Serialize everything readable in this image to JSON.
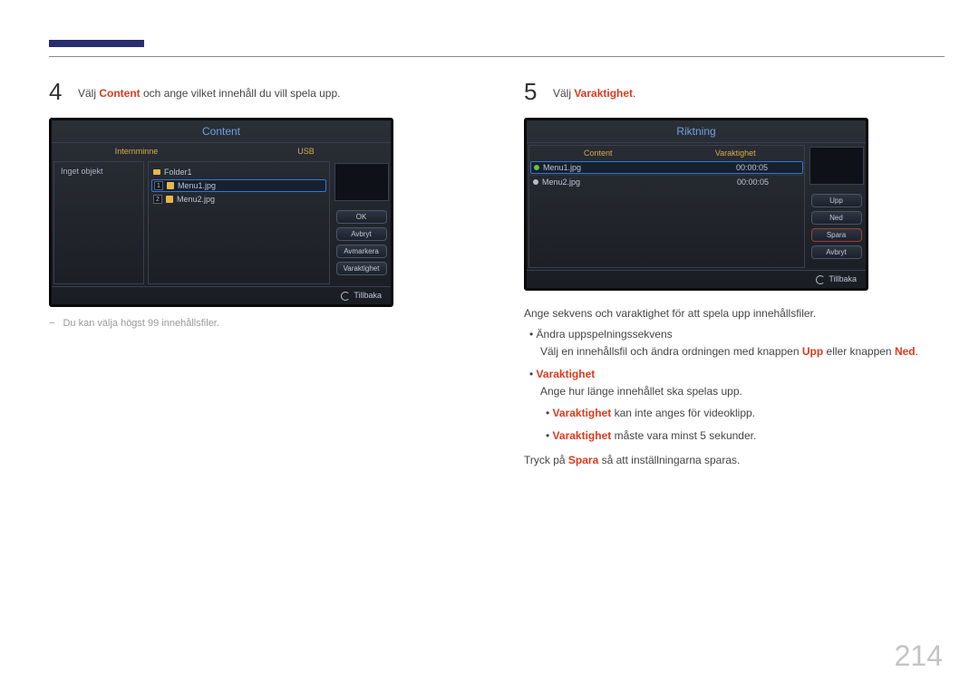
{
  "page_number": "214",
  "step4": {
    "num": "4",
    "text_prefix": "Välj ",
    "text_bold": "Content",
    "text_suffix": " och ange vilket innehåll du vill spela upp.",
    "note_prefix": "− ",
    "note": "Du kan välja högst 99 innehållsfiler."
  },
  "screen4": {
    "title": "Content",
    "tab1": "Internminne",
    "tab2": "USB",
    "left_label": "Inget objekt",
    "folder": "Folder1",
    "file1_idx": "1",
    "file1": "Menu1.jpg",
    "file2_idx": "2",
    "file2": "Menu2.jpg",
    "btn_ok": "OK",
    "btn_cancel": "Avbryt",
    "btn_unmark": "Avmarkera",
    "btn_duration": "Varaktighet",
    "footer": "Tillbaka"
  },
  "step5": {
    "num": "5",
    "text_prefix": "Välj ",
    "text_bold": "Varaktighet",
    "text_suffix": "."
  },
  "screen5": {
    "title": "Riktning",
    "col1": "Content",
    "col2": "Varaktighet",
    "row1_file": "Menu1.jpg",
    "row1_dur": "00:00:05",
    "row2_file": "Menu2.jpg",
    "row2_dur": "00:00:05",
    "btn_up": "Upp",
    "btn_down": "Ned",
    "btn_save": "Spara",
    "btn_cancel": "Avbryt",
    "footer": "Tillbaka"
  },
  "desc5": {
    "intro": "Ange sekvens och varaktighet för att spela upp innehållsfiler.",
    "b1_title": "Ändra uppspelningssekvens",
    "b1_body_a": "Välj en innehållsfil och ändra ordningen med knappen ",
    "b1_up": "Upp",
    "b1_mid": " eller knappen ",
    "b1_down": "Ned",
    "b1_end": ".",
    "b2_title": "Varaktighet",
    "b2_body": "Ange hur länge innehållet ska spelas upp.",
    "b2_s1a": "Varaktighet",
    "b2_s1b": " kan inte anges för videoklipp.",
    "b2_s2a": "Varaktighet",
    "b2_s2b": " måste vara minst 5 sekunder.",
    "outro_a": "Tryck på ",
    "outro_b": "Spara",
    "outro_c": " så att inställningarna sparas."
  }
}
